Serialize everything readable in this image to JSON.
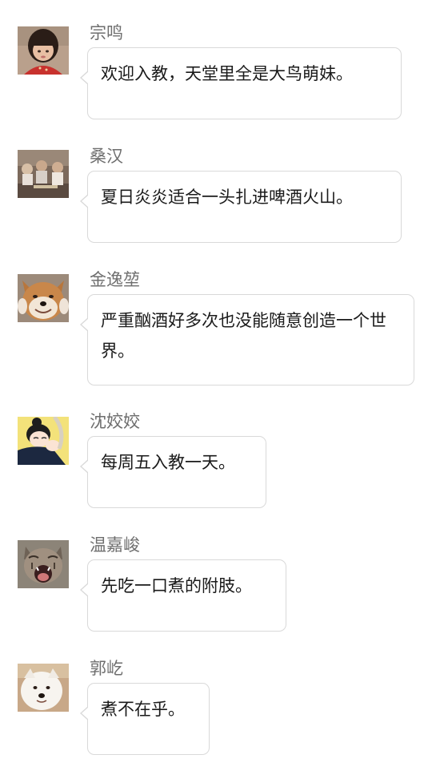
{
  "messages": [
    {
      "name": "宗鸣",
      "text": "欢迎入教，天堂里全是大鸟萌妹。",
      "avatar": "girl-avatar-icon"
    },
    {
      "name": "桑汉",
      "text": "夏日炎炎适合一头扎进啤酒火山。",
      "avatar": "group-photo-avatar-icon"
    },
    {
      "name": "金逸堃",
      "text": "严重酗酒好多次也没能随意创造一个世界。",
      "avatar": "shiba-dog-avatar-icon"
    },
    {
      "name": "沈姣姣",
      "text": "每周五入教一天。",
      "avatar": "cartoon-girl-avatar-icon"
    },
    {
      "name": "温嘉峻",
      "text": "先吃一口煮的附肢。",
      "avatar": "yawning-cat-avatar-icon"
    },
    {
      "name": "郭屹",
      "text": "煮不在乎。",
      "avatar": "white-dog-avatar-icon"
    }
  ]
}
